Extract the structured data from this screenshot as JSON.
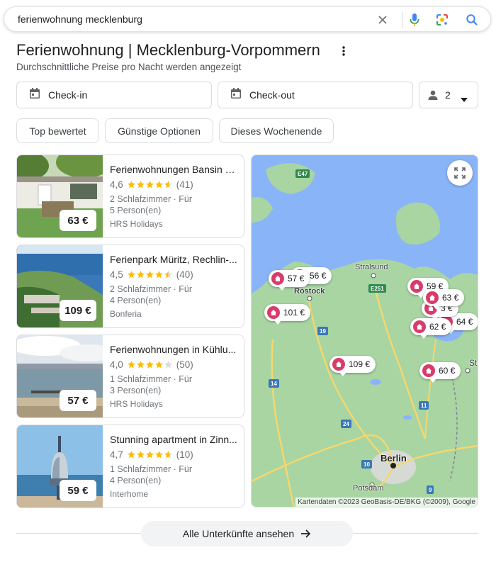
{
  "search": {
    "query": "ferienwohnung mecklenburg"
  },
  "header": {
    "title": "Ferienwohnung | Mecklenburg-Vorpommern",
    "subtitle": "Durchschnittliche Preise pro Nacht werden angezeigt"
  },
  "filters": {
    "checkin_label": "Check-in",
    "checkout_label": "Check-out",
    "guests": "2",
    "chips": [
      "Top bewertet",
      "Günstige Optionen",
      "Dieses Wochenende"
    ]
  },
  "listings": [
    {
      "name": "Ferienwohnungen Bansin U...",
      "rating": "4,6",
      "rating_value": 4.6,
      "reviews": "(41)",
      "rooms": "2 Schlafzimmer · Für",
      "guests": "5 Person(en)",
      "provider": "HRS Holidays",
      "price": "63 €"
    },
    {
      "name": "Ferienpark Müritz, Rechlin-...",
      "rating": "4,5",
      "rating_value": 4.5,
      "reviews": "(40)",
      "rooms": "2 Schlafzimmer · Für",
      "guests": "4 Person(en)",
      "provider": "Bonferia",
      "price": "109 €"
    },
    {
      "name": "Ferienwohnungen in Kühlu...",
      "rating": "4,0",
      "rating_value": 4.0,
      "reviews": "(50)",
      "rooms": "1 Schlafzimmer · Für",
      "guests": "3 Person(en)",
      "provider": "HRS Holidays",
      "price": "57 €"
    },
    {
      "name": "Stunning apartment in Zinn...",
      "rating": "4,7",
      "rating_value": 4.7,
      "reviews": "(10)",
      "rooms": "1 Schlafzimmer · Für",
      "guests": "4 Person(en)",
      "provider": "Interhome",
      "price": "59 €"
    }
  ],
  "map": {
    "pins": [
      "56 €",
      "57 €",
      "101 €",
      "109 €",
      "60 €",
      "59 €",
      "63 €",
      "3 €",
      "64 €",
      "62 €",
      "60 €"
    ],
    "cities": [
      "Stralsund",
      "Rostock",
      "Berlin",
      "Potsdam",
      "Stetti"
    ],
    "roads": [
      "E47",
      "E251",
      "19",
      "14",
      "24",
      "10",
      "11",
      "9"
    ],
    "attribution": "Kartendaten ©2023 GeoBasis-DE/BKG (©2009), Google"
  },
  "footer": {
    "all_button": "Alle Unterkünfte ansehen"
  },
  "colors": {
    "star": "#fbbc04",
    "pin": "#d93b6a",
    "map_land": "#a8d5a2",
    "map_water": "#8ab4f8"
  },
  "icons": [
    "clear-icon",
    "mic-icon",
    "lens-icon",
    "search-icon",
    "more-vert-icon",
    "calendar-icon",
    "person-icon",
    "dropdown-icon",
    "expand-icon",
    "arrow-right-icon",
    "house-icon",
    "star-icon"
  ]
}
